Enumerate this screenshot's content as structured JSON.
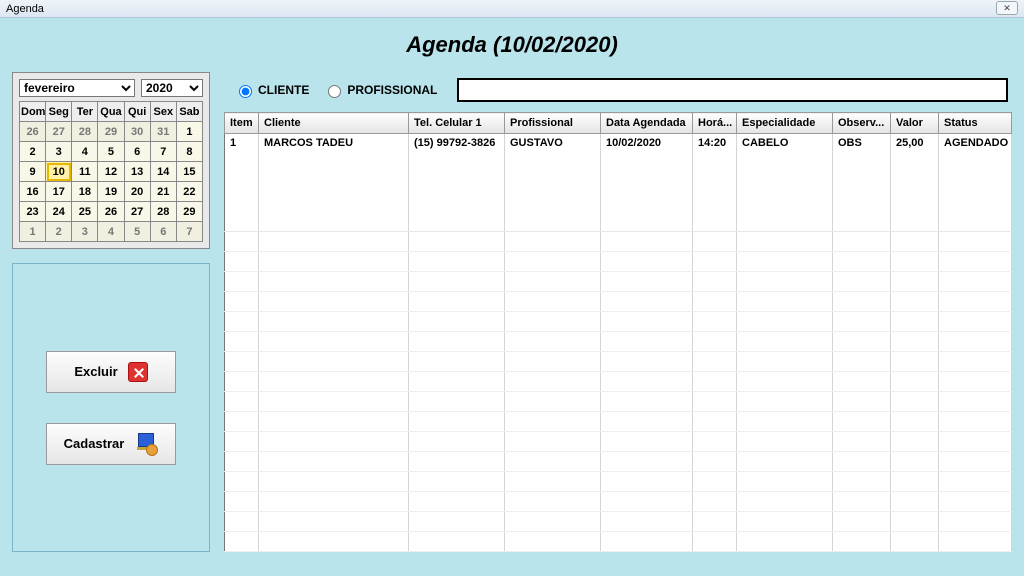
{
  "window": {
    "title": "Agenda"
  },
  "page_title": "Agenda (10/02/2020)",
  "calendar": {
    "month": "fevereiro",
    "year": "2020",
    "dow": [
      "Dom",
      "Seg",
      "Ter",
      "Qua",
      "Qui",
      "Sex",
      "Sab"
    ],
    "weeks": [
      [
        {
          "d": "26",
          "other": true
        },
        {
          "d": "27",
          "other": true
        },
        {
          "d": "28",
          "other": true
        },
        {
          "d": "29",
          "other": true
        },
        {
          "d": "30",
          "other": true
        },
        {
          "d": "31",
          "other": true
        },
        {
          "d": "1"
        }
      ],
      [
        {
          "d": "2"
        },
        {
          "d": "3"
        },
        {
          "d": "4"
        },
        {
          "d": "5"
        },
        {
          "d": "6"
        },
        {
          "d": "7"
        },
        {
          "d": "8"
        }
      ],
      [
        {
          "d": "9"
        },
        {
          "d": "10",
          "sel": true
        },
        {
          "d": "11"
        },
        {
          "d": "12"
        },
        {
          "d": "13"
        },
        {
          "d": "14"
        },
        {
          "d": "15"
        }
      ],
      [
        {
          "d": "16"
        },
        {
          "d": "17"
        },
        {
          "d": "18"
        },
        {
          "d": "19"
        },
        {
          "d": "20"
        },
        {
          "d": "21"
        },
        {
          "d": "22"
        }
      ],
      [
        {
          "d": "23"
        },
        {
          "d": "24"
        },
        {
          "d": "25"
        },
        {
          "d": "26"
        },
        {
          "d": "27"
        },
        {
          "d": "28"
        },
        {
          "d": "29"
        }
      ],
      [
        {
          "d": "1",
          "other": true
        },
        {
          "d": "2",
          "other": true
        },
        {
          "d": "3",
          "other": true
        },
        {
          "d": "4",
          "other": true
        },
        {
          "d": "5",
          "other": true
        },
        {
          "d": "6",
          "other": true
        },
        {
          "d": "7",
          "other": true
        }
      ]
    ]
  },
  "actions": {
    "delete_label": "Excluir",
    "create_label": "Cadastrar"
  },
  "filter": {
    "option_client": "CLIENTE",
    "option_professional": "PROFISSIONAL",
    "selected": "CLIENTE",
    "search_value": ""
  },
  "grid": {
    "columns": [
      "Item",
      "Cliente",
      "Tel. Celular 1",
      "Profissional",
      "Data Agendada",
      "Horá...",
      "Especialidade",
      "Observ...",
      "Valor",
      "Status"
    ],
    "col_widths": [
      "34px",
      "150px",
      "96px",
      "96px",
      "92px",
      "44px",
      "96px",
      "58px",
      "48px",
      "auto"
    ],
    "rows": [
      {
        "item": "1",
        "cliente": "MARCOS TADEU",
        "tel": "(15) 99792-3826",
        "prof": "GUSTAVO",
        "data": "10/02/2020",
        "hora": "14:20",
        "esp": "CABELO",
        "obs": "OBS",
        "valor": "25,00",
        "status": "AGENDADO"
      }
    ],
    "empty_rows": 16
  }
}
